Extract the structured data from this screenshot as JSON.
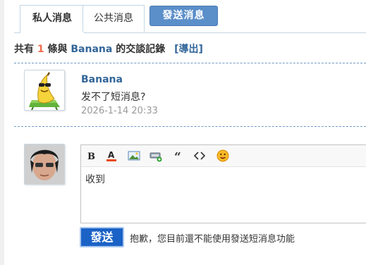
{
  "tabs": [
    {
      "label": "私人消息",
      "active": true
    },
    {
      "label": "公共消息",
      "active": false
    },
    {
      "label": "發送消息",
      "active": false
    }
  ],
  "summary": {
    "prefix": "共有",
    "count": "1",
    "middle": "條與",
    "contact": "Banana",
    "suffix": "的交談記錄",
    "export_label": "[導出]"
  },
  "message": {
    "from": "Banana",
    "text": "发不了短消息?",
    "time": "2026-1-14 20:33",
    "avatar_icon": "banana-sunglasses-icon"
  },
  "reply": {
    "avatar_icon": "user-photo",
    "toolbar_icons": [
      "bold-icon",
      "font-color-icon",
      "image-icon",
      "attachment-icon",
      "quote-icon",
      "code-icon",
      "smiley-icon"
    ],
    "body_text": "收到",
    "send_label": "發送",
    "notice": "抱歉，您目前還不能使用發送短消息功能"
  },
  "colors": {
    "link": "#336699",
    "accent_count": "#f26c4f",
    "send_button": "#1a62c6",
    "tab_send": "#5b8fc9"
  }
}
